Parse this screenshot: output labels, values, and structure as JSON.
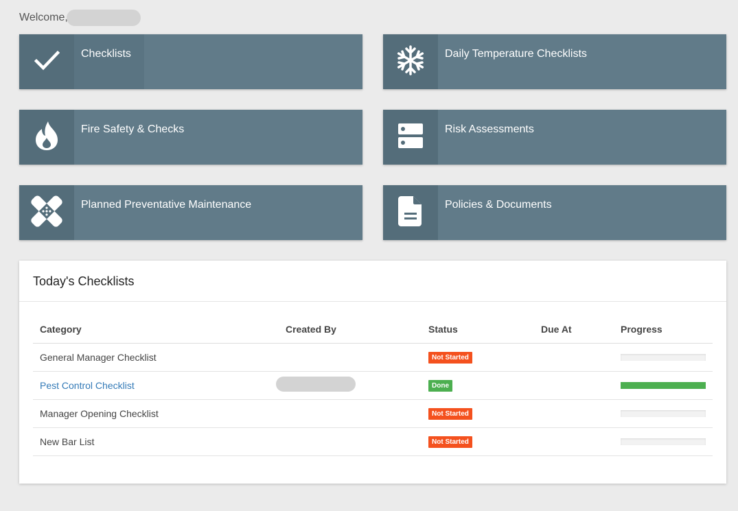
{
  "welcome": {
    "text": "Welcome,"
  },
  "tiles": [
    {
      "label": "Checklists",
      "icon": "checkmark-icon"
    },
    {
      "label": "Daily Temperature Checklists",
      "icon": "snowflake-icon"
    },
    {
      "label": "Fire Safety & Checks",
      "icon": "flame-icon"
    },
    {
      "label": "Risk Assessments",
      "icon": "server-icon"
    },
    {
      "label": "Planned Preventative Maintenance",
      "icon": "bandage-icon"
    },
    {
      "label": "Policies & Documents",
      "icon": "document-icon"
    }
  ],
  "checklists_panel": {
    "title": "Today's Checklists",
    "columns": [
      "Category",
      "Created By",
      "Status",
      "Due At",
      "Progress"
    ],
    "rows": [
      {
        "category": "General Manager Checklist",
        "created_by": "",
        "status": "Not Started",
        "due_at": "",
        "progress": 0
      },
      {
        "category": "Pest Control Checklist",
        "created_by": "",
        "status": "Done",
        "due_at": "",
        "progress": 1
      },
      {
        "category": "Manager Opening Checklist",
        "created_by": "",
        "status": "Not Started",
        "due_at": "",
        "progress": 0
      },
      {
        "category": "New Bar List",
        "created_by": "",
        "status": "Not Started",
        "due_at": "",
        "progress": 0
      }
    ]
  },
  "colors": {
    "tile_bg": "#617b89",
    "tile_icon_bg": "#546d7a",
    "status_not_started": "#f4511e",
    "status_done": "#4caf50",
    "link": "#337ab7"
  }
}
